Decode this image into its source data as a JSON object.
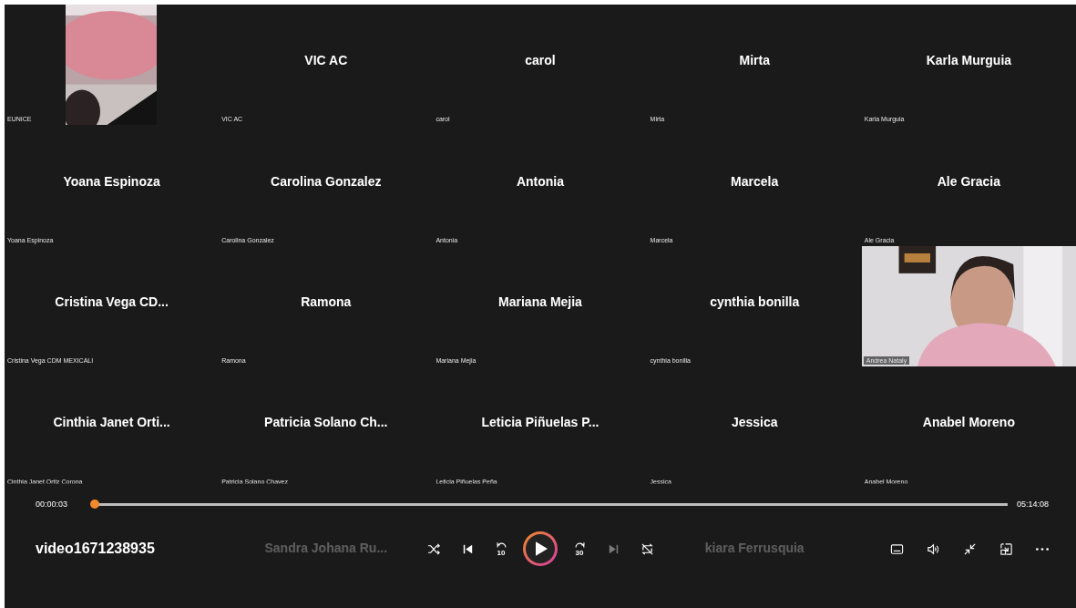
{
  "gallery": {
    "rows": [
      {
        "tiles": [
          {
            "kind": "camera_narrow",
            "label": "EUNICE"
          },
          {
            "kind": "avatar",
            "name": "VIC AC",
            "label": "VIC AC"
          },
          {
            "kind": "avatar",
            "name": "carol",
            "label": "carol"
          },
          {
            "kind": "avatar",
            "name": "Mirta",
            "label": "Mirta"
          },
          {
            "kind": "avatar",
            "name": "Karla Murguia",
            "label": "Karla Murguia"
          }
        ]
      },
      {
        "tiles": [
          {
            "kind": "avatar",
            "name": "Yoana Espinoza",
            "label": "Yoana Espinoza"
          },
          {
            "kind": "avatar",
            "name": "Carolina Gonzalez",
            "label": "Carolina Gonzalez"
          },
          {
            "kind": "avatar",
            "name": "Antonia",
            "label": "Antonia"
          },
          {
            "kind": "avatar",
            "name": "Marcela",
            "label": "Marcela"
          },
          {
            "kind": "avatar",
            "name": "Ale Gracia",
            "label": "Ale Gracia"
          }
        ]
      },
      {
        "tiles": [
          {
            "kind": "avatar",
            "name": "Cristina Vega CD...",
            "label": "Cristina Vega CDM MEXICALI"
          },
          {
            "kind": "avatar",
            "name": "Ramona",
            "label": "Ramona"
          },
          {
            "kind": "avatar",
            "name": "Mariana Mejia",
            "label": "Mariana Mejia"
          },
          {
            "kind": "avatar",
            "name": "cynthia bonilla",
            "label": "cynthia bonilla"
          },
          {
            "kind": "camera_full",
            "label": "Andrea Nataly"
          }
        ]
      },
      {
        "tiles": [
          {
            "kind": "avatar",
            "name": "Cinthia Janet Orti...",
            "label": "Cinthia Janet Ortiz Corona"
          },
          {
            "kind": "avatar",
            "name": "Patricia Solano Ch...",
            "label": "Patricia Solano Chavez"
          },
          {
            "kind": "avatar",
            "name": "Leticia Piñuelas P...",
            "label": "Leticia Piñuelas Peña"
          },
          {
            "kind": "avatar",
            "name": "Jessica",
            "label": "Jessica"
          },
          {
            "kind": "avatar",
            "name": "Anabel Moreno",
            "label": "Anabel Moreno"
          }
        ]
      },
      {
        "tiles": [
          {
            "kind": "avatar"
          },
          {
            "kind": "avatar",
            "name": "Sandra Johana Ru..."
          },
          {
            "kind": "avatar"
          },
          {
            "kind": "avatar",
            "name": "kiara Ferrusquia"
          },
          {
            "kind": "avatar"
          }
        ]
      }
    ]
  },
  "player": {
    "elapsed": "00:00:03",
    "duration": "05:14:08",
    "progress": {
      "level": 0.0002
    },
    "title": "video1671238935",
    "center_controls": [
      {
        "kind": "shuffle",
        "disabled": false
      },
      {
        "kind": "previous",
        "disabled": false
      },
      {
        "kind": "rewind",
        "label": "10",
        "disabled": false
      },
      {
        "kind": "play",
        "disabled": false
      },
      {
        "kind": "forward",
        "label": "30",
        "disabled": false
      },
      {
        "kind": "next",
        "disabled": true
      },
      {
        "kind": "repeat",
        "disabled": false
      }
    ],
    "right_controls": [
      {
        "kind": "subtitles"
      },
      {
        "kind": "volume"
      },
      {
        "kind": "exit_fullscreen"
      },
      {
        "kind": "miniplayer"
      },
      {
        "kind": "more"
      }
    ]
  }
}
